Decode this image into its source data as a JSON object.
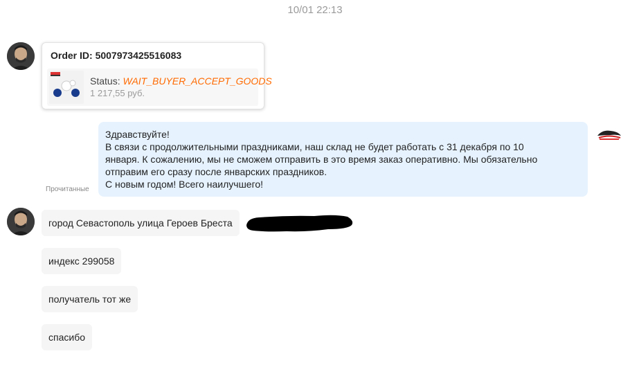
{
  "chat": {
    "timestamp": "10/01 22:13"
  },
  "order_card": {
    "order_id": "Order ID: 5007973425516083",
    "status_label": "Status:",
    "status_value": "WAIT_BUYER_ACCEPT_GOODS",
    "price": "1 217,55 руб.",
    "thumbnail_icon": "product-thumbnail-icon"
  },
  "seller_message": {
    "lines": [
      "Здравствуйте!",
      "В связи с продолжительными праздниками, наш склад не будет работать с 31 декабря по 10",
      "января. К сожалению, мы не сможем отправить в это время заказ оперативно. Мы обязательно",
      "отправим его сразу после январских праздников.",
      "С новым годом! Всего наилучшего!"
    ],
    "read_status": "Прочитанные"
  },
  "buyer_messages": [
    "город Севастополь улица Героев Бреста",
    "индекс 299058",
    "получатель тот же",
    "спасибо"
  ],
  "colors": {
    "status_orange": "#ff6a00",
    "seller_bubble": "#e6f3ff",
    "buyer_bubble": "#f5f5f5",
    "timestamp_gray": "#9a9a9a"
  }
}
